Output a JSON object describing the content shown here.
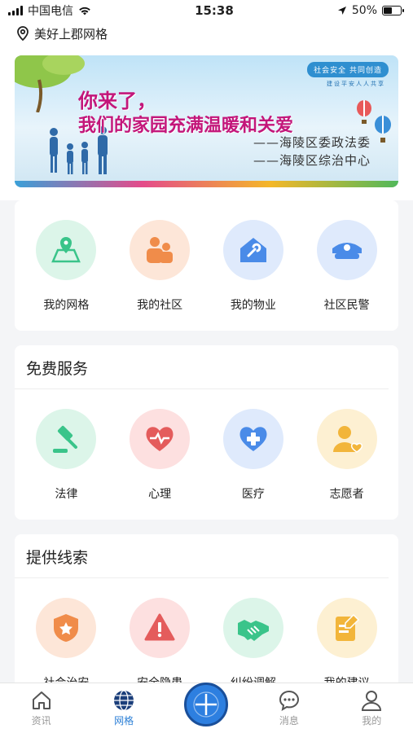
{
  "status_bar": {
    "carrier": "中国电信",
    "time": "15:38",
    "battery": "50%",
    "battery_level": 0.5
  },
  "location": {
    "name": "美好上郡网格"
  },
  "banner": {
    "tag": "社会安全 共同创造",
    "subtag": "建设平安人人共享",
    "line1": "你来了，",
    "line2": "我们的家园充满温暖和关爱",
    "sign1": "——海陵区委政法委",
    "sign2": "——海陵区综治中心"
  },
  "quick_links": {
    "items": [
      {
        "label": "我的网格",
        "icon": "map-pin-icon",
        "bg": "#dcf5e9",
        "color": "#3ac48a"
      },
      {
        "label": "我的社区",
        "icon": "community-icon",
        "bg": "#fde6d8",
        "color": "#f08c4a"
      },
      {
        "label": "我的物业",
        "icon": "property-icon",
        "bg": "#dfeafc",
        "color": "#4a8be8"
      },
      {
        "label": "社区民警",
        "icon": "police-cap-icon",
        "bg": "#dfeafc",
        "color": "#4a8be8"
      }
    ]
  },
  "free_services": {
    "title": "免费服务",
    "items": [
      {
        "label": "法律",
        "icon": "gavel-icon",
        "bg": "#dcf5e9",
        "color": "#3ac48a"
      },
      {
        "label": "心理",
        "icon": "heart-pulse-icon",
        "bg": "#fde0e0",
        "color": "#e45c5c"
      },
      {
        "label": "医疗",
        "icon": "medical-heart-icon",
        "bg": "#dfeafc",
        "color": "#4a8be8"
      },
      {
        "label": "志愿者",
        "icon": "volunteer-icon",
        "bg": "#fdf0d2",
        "color": "#f2b53a"
      }
    ]
  },
  "clues": {
    "title": "提供线索",
    "items": [
      {
        "label": "社会治安",
        "icon": "badge-star-icon",
        "bg": "#fde6d8",
        "color": "#f08c4a"
      },
      {
        "label": "安全隐患",
        "icon": "warning-icon",
        "bg": "#fde0e0",
        "color": "#e45c5c"
      },
      {
        "label": "纠纷调解",
        "icon": "handshake-icon",
        "bg": "#dcf5e9",
        "color": "#3ac48a"
      },
      {
        "label": "我的建议",
        "icon": "note-pen-icon",
        "bg": "#fdf0d2",
        "color": "#f2b53a"
      }
    ]
  },
  "tab_bar": {
    "tabs": [
      {
        "label": "资讯",
        "icon": "home-icon"
      },
      {
        "label": "网格",
        "icon": "globe-icon",
        "active": true
      },
      {
        "label": "",
        "icon": "plus-center-icon"
      },
      {
        "label": "消息",
        "icon": "message-icon"
      },
      {
        "label": "我的",
        "icon": "user-icon"
      }
    ]
  }
}
